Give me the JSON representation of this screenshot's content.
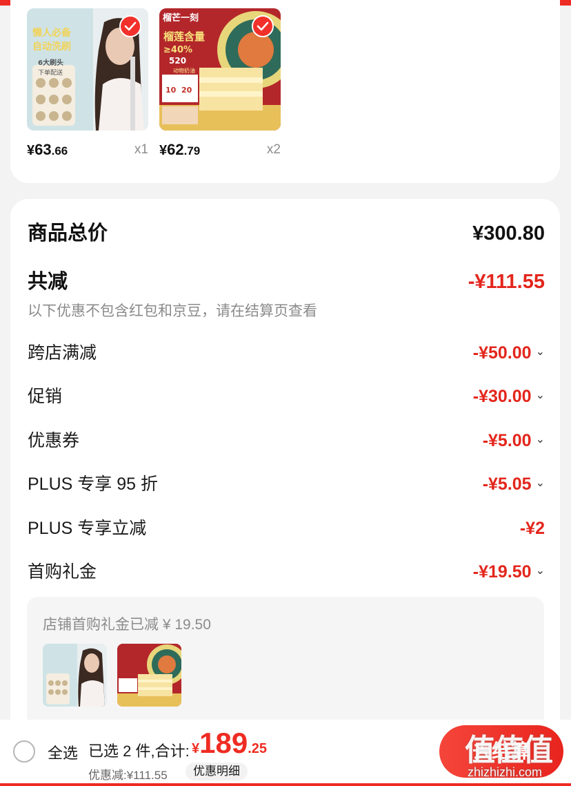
{
  "products": [
    {
      "price_currency": "¥",
      "price_int": "63",
      "price_dec": ".66",
      "qty": "x1",
      "image": {
        "badge": "懒人必备",
        "tagline": "自动洗刷",
        "promo_top": "下单配送",
        "promo_bottom": "6大刷头"
      }
    },
    {
      "price_currency": "¥",
      "price_int": "62",
      "price_dec": ".79",
      "qty": "x2",
      "image": {
        "brand": "榴芒一刻",
        "title": "榴莲含量",
        "percent": "≥40%",
        "tag": "520",
        "tag2": "动物奶油",
        "coupon_a": "10",
        "coupon_b": "20"
      }
    }
  ],
  "summary": {
    "total_label": "商品总价",
    "total_value": "¥300.80",
    "reduce_label": "共减",
    "reduce_value": "-¥111.55",
    "note": "以下优惠不包含红包和京豆，请在结算页查看",
    "items": [
      {
        "label": "跨店满减",
        "value": "-¥50.00",
        "expand_icon": "chevron-down-icon"
      },
      {
        "label": "促销",
        "value": "-¥30.00",
        "expand_icon": "chevron-down-icon"
      },
      {
        "label": "优惠券",
        "value": "-¥5.00",
        "expand_icon": "chevron-down-icon"
      },
      {
        "label": "PLUS 专享 95 折",
        "value": "-¥5.05",
        "expand_icon": "chevron-down-icon"
      },
      {
        "label": "PLUS 专享立减",
        "value": "-¥2",
        "expand_icon": ""
      },
      {
        "label": "首购礼金",
        "value": "-¥19.50",
        "expand_icon": "chevron-down-icon"
      }
    ],
    "gift_title": "店铺首购礼金已减 ¥ 19.50"
  },
  "bottom_bar": {
    "select_all": "全选",
    "selected_text": "已选 2 件,合计:",
    "sum_currency": "¥",
    "sum_int": "189",
    "sum_dec": ".25",
    "discount_text": "优惠减:¥111.55",
    "detail_button": "优惠明细",
    "checkout_button": "去结算"
  },
  "watermark": {
    "main": "值值值",
    "url": "zhizhizhi.com"
  },
  "colors": {
    "accent": "#e3261c",
    "price_red": "#ef2c22",
    "checkout_start": "#f5453a",
    "checkout_end": "#e8241d"
  }
}
